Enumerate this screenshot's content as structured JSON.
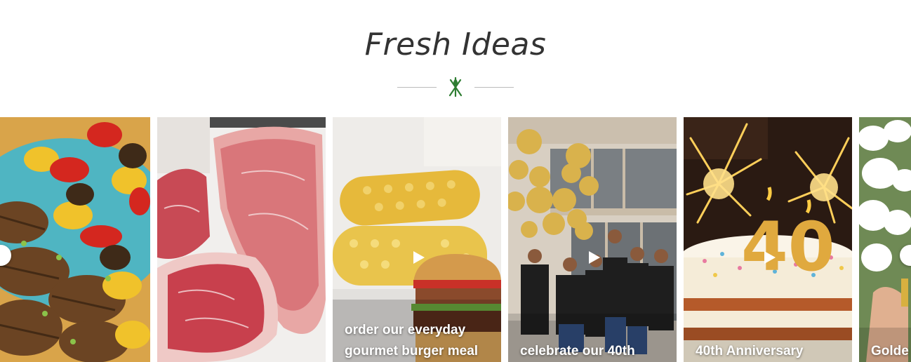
{
  "section": {
    "title": "Fresh Ideas"
  },
  "colors": {
    "accent": "#2e7d32",
    "divider": "#bbbbbb"
  },
  "icons": {
    "divider_emblem": "fork-knife-leaf-icon",
    "play": "play-icon"
  },
  "cards": [
    {
      "caption": "",
      "image": "grilled-kebabs"
    },
    {
      "caption": "",
      "image": "raw-steaks"
    },
    {
      "caption": "order our everyday gourmet burger meal",
      "image": "corn-and-burger",
      "video": true
    },
    {
      "caption": "celebrate our 40th",
      "image": "team-with-gold-balloons",
      "video": true
    },
    {
      "caption": "40th Anniversary",
      "image": "anniversary-cake",
      "video": true
    },
    {
      "caption": "Golde",
      "image": "white-orchids"
    }
  ]
}
